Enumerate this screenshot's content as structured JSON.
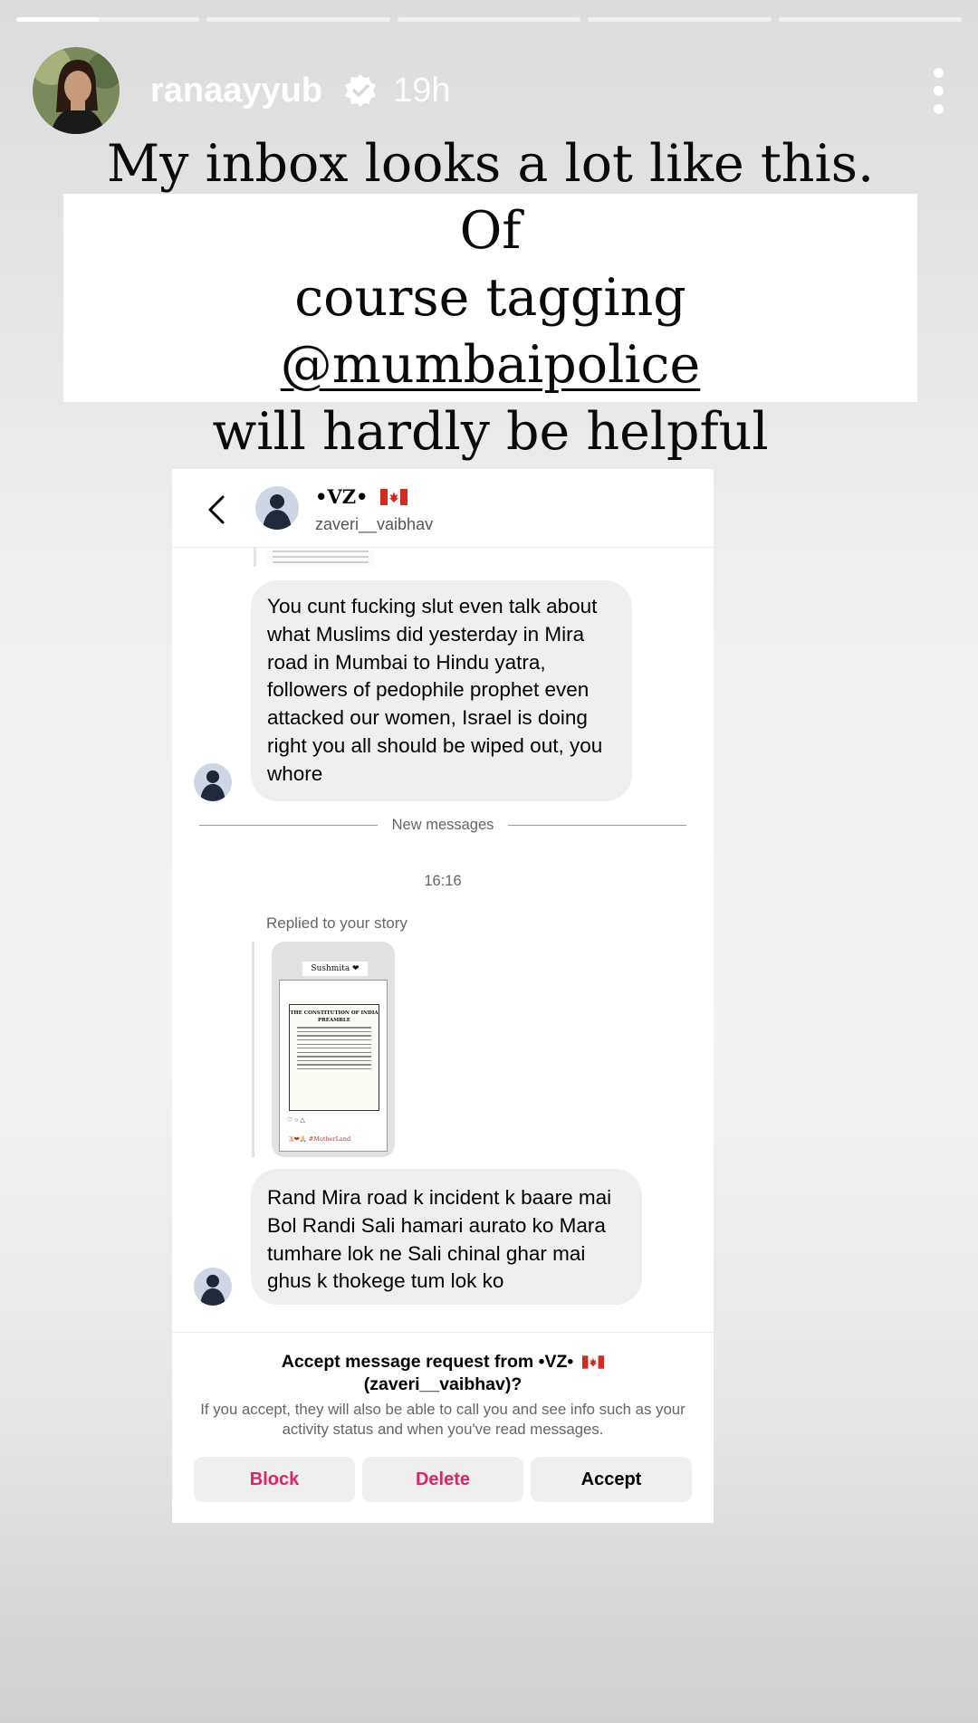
{
  "story": {
    "progress": {
      "segments": 5,
      "active_index": 0,
      "active_fill": 0.45
    },
    "username": "ranaayyub",
    "time": "19h",
    "caption": {
      "line1": "My inbox looks a lot like this. Of",
      "line2_pre": "course tagging ",
      "tag": "@mumbaipolice",
      "line3": "will hardly be helpful"
    }
  },
  "dm": {
    "display_name": "•VZ•",
    "username": "zaveri__vaibhav",
    "flag": "canada-flag-icon",
    "message1": "You cunt fucking slut even talk about what Muslims did yesterday in Mira road in Mumbai to Hindu yatra, followers of pedophile prophet even attacked our women, Israel is doing right you all should be wiped out, you whore",
    "new_messages_label": "New messages",
    "timestamp": "16:16",
    "replied_label": "Replied to your story",
    "story_thumb": {
      "title": "Sushmita ❤",
      "doc_heading": "THE CONSTITUTION OF INDIA",
      "doc_sub": "PREAMBLE",
      "footer": "🇧❤🙏 #MotherLand"
    },
    "message2": "Rand Mira road k incident k baare mai Bol Randi Sali hamari aurato ko Mara tumhare lok ne Sali chinal ghar mai ghus k thokege tum lok ko"
  },
  "request": {
    "title_pre": "Accept message request from •VZ•",
    "title_user": "(zaveri__vaibhav)?",
    "description": "If you accept, they will also be able to call you and see info such as your activity status and when you've read messages.",
    "block": "Block",
    "delete": "Delete",
    "accept": "Accept"
  },
  "colors": {
    "red": "#e0245e",
    "bubble": "#efefef",
    "verified": "#ffffff"
  }
}
